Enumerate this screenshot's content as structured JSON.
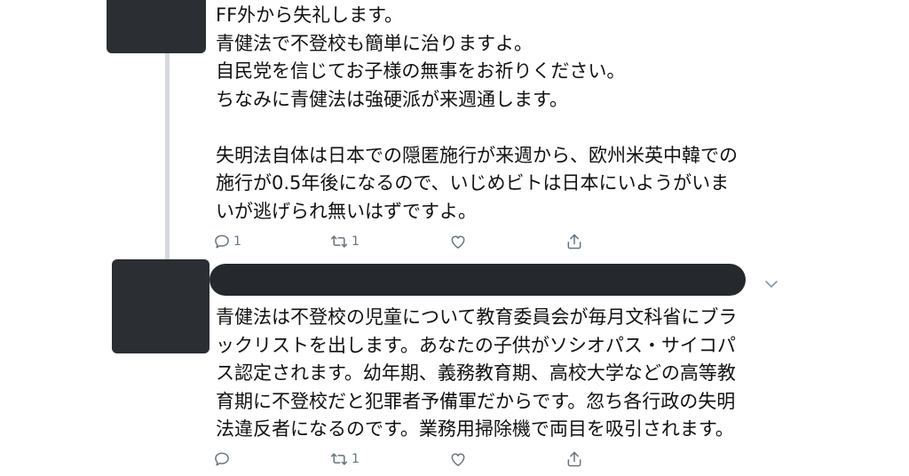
{
  "tweet1": {
    "lines": [
      "FF外から失礼します。",
      "青健法で不登校も簡単に治りますよ。",
      "自民党を信じてお子様の無事をお祈りください。",
      "ちなみに青健法は強硬派が来週通します。",
      "",
      "失明法自体は日本での隠匿施行が来週から、欧州米英中韓での",
      "施行が0.5年後になるので、いじめビトは日本にいようがいま",
      "いが逃げられ無いはずですよ。"
    ],
    "reply_count": "1",
    "retweet_count": "1",
    "like_count": "",
    "icons": [
      "reply-icon",
      "retweet-icon",
      "like-icon",
      "share-icon"
    ]
  },
  "tweet2": {
    "lines": [
      "青健法は不登校の児童について教育委員会が毎月文科省にブラ",
      "ックリストを出します。あなたの子供がソシオパス・サイコパ",
      "ス認定されます。幼年期、義務教育期、高校大学などの高等教",
      "育期に不登校だと犯罪者予備軍だからです。忽ち各行政の失明",
      "法違反者になるのです。業務用掃除機で両目を吸引されます。"
    ],
    "reply_count": "",
    "retweet_count": "1",
    "like_count": "",
    "icons": [
      "reply-icon",
      "retweet-icon",
      "like-icon",
      "share-icon"
    ]
  },
  "colors": {
    "avatar": "#2b2f33",
    "redaction": "#25292d",
    "thread_line": "#d5d8dc",
    "action_icon": "#66757f"
  }
}
